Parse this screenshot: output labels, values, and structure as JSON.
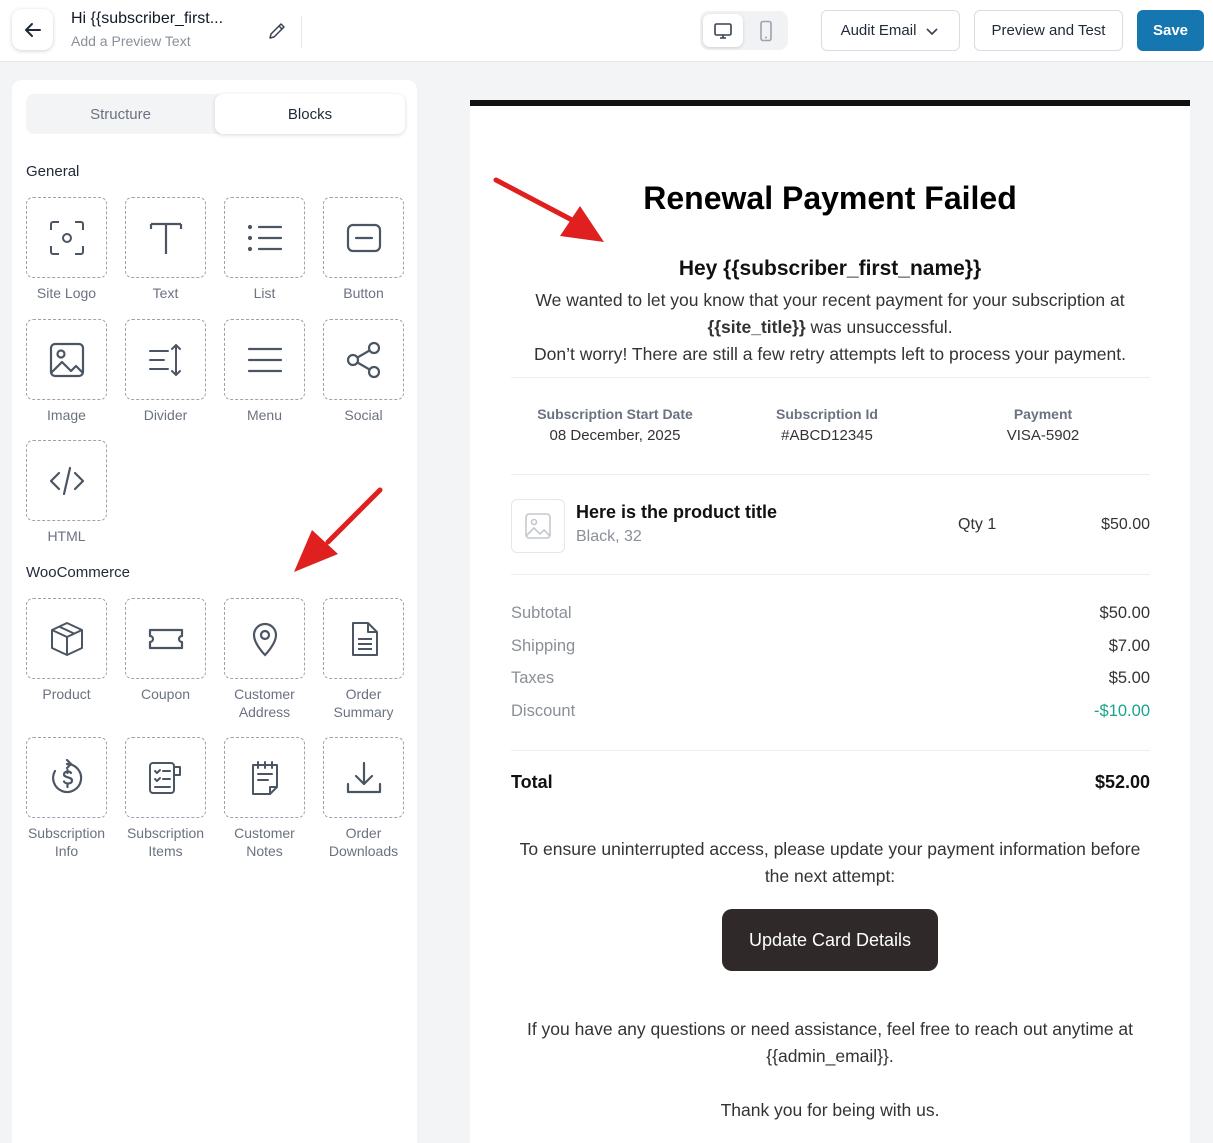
{
  "header": {
    "subject": "Hi {{subscriber_first...",
    "preview_placeholder": "Add a Preview Text",
    "audit_label": "Audit Email",
    "preview_test_label": "Preview and Test",
    "save_label": "Save"
  },
  "sidebar": {
    "tabs": [
      "Structure",
      "Blocks"
    ],
    "active_tab": "Blocks",
    "general_title": "General",
    "general_blocks": [
      {
        "label": "Site Logo",
        "icon": "site-logo-icon"
      },
      {
        "label": "Text",
        "icon": "text-icon"
      },
      {
        "label": "List",
        "icon": "list-icon"
      },
      {
        "label": "Button",
        "icon": "button-icon"
      },
      {
        "label": "Image",
        "icon": "image-icon"
      },
      {
        "label": "Divider",
        "icon": "divider-icon"
      },
      {
        "label": "Menu",
        "icon": "menu-icon"
      },
      {
        "label": "Social",
        "icon": "share-icon"
      },
      {
        "label": "HTML",
        "icon": "code-icon"
      }
    ],
    "woo_title": "WooCommerce",
    "woo_blocks": [
      {
        "label": "Product",
        "icon": "box-icon"
      },
      {
        "label": "Coupon",
        "icon": "ticket-icon"
      },
      {
        "label": "Customer Address",
        "icon": "location-pin-icon"
      },
      {
        "label": "Order Summary",
        "icon": "document-icon"
      },
      {
        "label": "Subscription Info",
        "icon": "recurring-dollar-icon"
      },
      {
        "label": "Subscription Items",
        "icon": "checklist-icon"
      },
      {
        "label": "Customer Notes",
        "icon": "notepad-icon"
      },
      {
        "label": "Order Downloads",
        "icon": "download-icon"
      }
    ]
  },
  "email": {
    "title": "Renewal Payment Failed",
    "greeting": "Hey {{subscriber_first_name}}",
    "intro_1": "We wanted to let you know that your recent payment for your subscription at",
    "site_title": "{{site_title}}",
    "intro_2": " was unsuccessful.",
    "intro_3": "Don’t worry! There are still a few retry attempts left to process your payment.",
    "info": [
      {
        "heading": "Subscription Start Date",
        "value": "08 December, 2025"
      },
      {
        "heading": "Subscription Id",
        "value": "#ABCD12345"
      },
      {
        "heading": "Payment",
        "value": "VISA-5902"
      }
    ],
    "product": {
      "title": "Here is the product title",
      "variant": "Black, 32",
      "qty": "Qty 1",
      "price": "$50.00"
    },
    "summary": [
      {
        "label": "Subtotal",
        "value": "$50.00"
      },
      {
        "label": "Shipping",
        "value": "$7.00"
      },
      {
        "label": "Taxes",
        "value": "$5.00"
      },
      {
        "label": "Discount",
        "value": "-$10.00"
      }
    ],
    "total_label": "Total",
    "total_value": "$52.00",
    "update_text": "To ensure uninterrupted access, please update your payment information before the next attempt:",
    "cta_label": "Update Card Details",
    "help_text": "If you have any questions or need assistance, feel free to reach out anytime at {{admin_email}}.",
    "thanks": "Thank you for being with us."
  },
  "colors": {
    "primary": "#1677b0",
    "cta": "#2f2a29",
    "discount": "#1aa38c",
    "annotation_arrow": "#e01f1f"
  }
}
